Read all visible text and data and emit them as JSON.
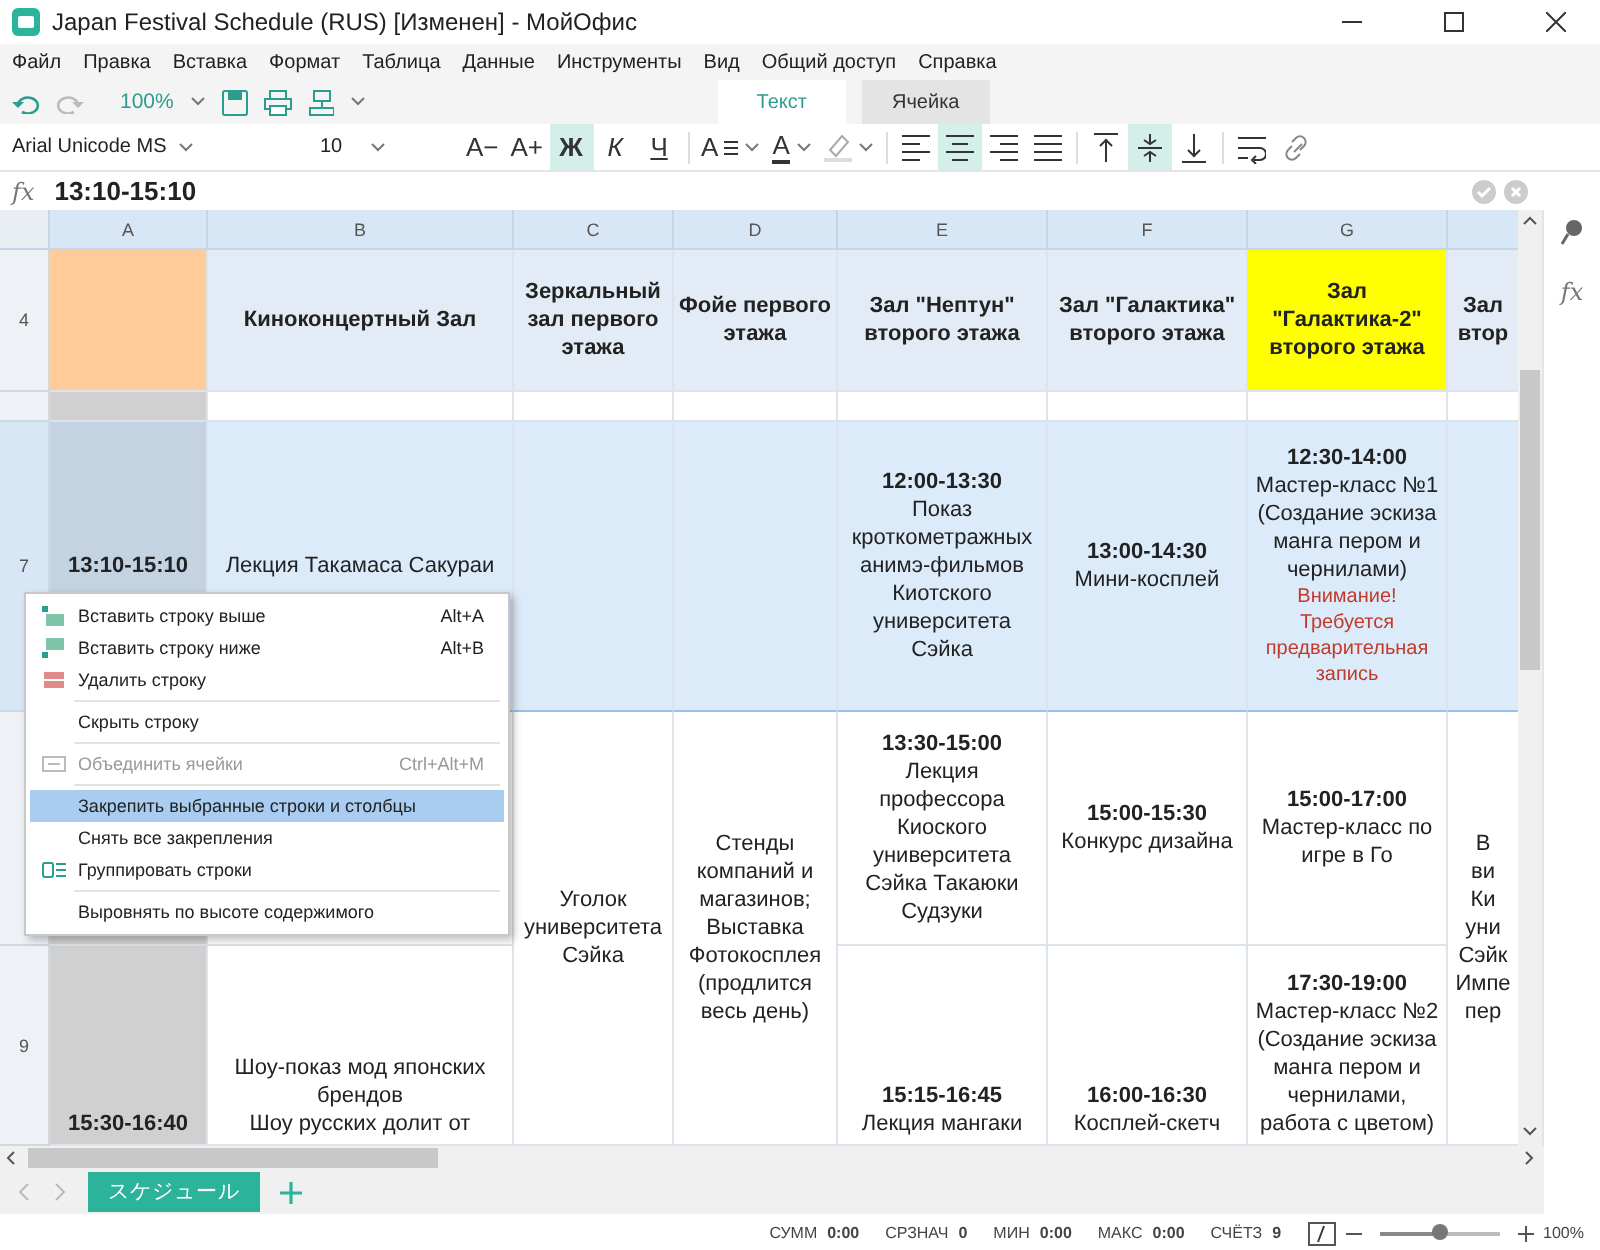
{
  "window": {
    "title": "Japan Festival Schedule (RUS) [Изменен] - МойОфис"
  },
  "menu": [
    "Файл",
    "Правка",
    "Вставка",
    "Формат",
    "Таблица",
    "Данные",
    "Инструменты",
    "Вид",
    "Общий доступ",
    "Справка"
  ],
  "quick_toolbar": {
    "zoom": "100%"
  },
  "ribbon_tabs": [
    {
      "label": "Текст",
      "selected": true
    },
    {
      "label": "Ячейка",
      "selected": false
    }
  ],
  "font": {
    "family": "Arial Unicode MS",
    "size": "10"
  },
  "format_buttons": [
    {
      "kind": "text",
      "label": "A−",
      "on": false
    },
    {
      "kind": "text",
      "label": "A+",
      "on": false
    },
    {
      "kind": "bold",
      "label": "Ж",
      "on": true
    },
    {
      "kind": "italic",
      "label": "К",
      "on": false
    },
    {
      "kind": "underline",
      "label": "Ч",
      "on": false
    },
    {
      "kind": "line-spacing",
      "label": "A",
      "on": false
    },
    {
      "kind": "font-color",
      "label": "A",
      "on": false
    },
    {
      "kind": "highlight",
      "on": false
    },
    {
      "kind": "align-left",
      "on": false
    },
    {
      "kind": "align-center",
      "on": true
    },
    {
      "kind": "align-right",
      "on": false
    },
    {
      "kind": "justify",
      "on": false
    },
    {
      "kind": "valign-top",
      "on": false
    },
    {
      "kind": "valign-middle",
      "on": true
    },
    {
      "kind": "valign-bottom",
      "on": false
    },
    {
      "kind": "wrap",
      "on": false
    },
    {
      "kind": "link",
      "on": false
    }
  ],
  "formula_bar": {
    "label": "fx",
    "value": "13:10-15:10"
  },
  "sheet": {
    "columns": [
      "A",
      "B",
      "C",
      "D",
      "E",
      "F",
      "G"
    ],
    "rows": [
      {
        "header": "4",
        "kind": "header",
        "selected": false,
        "cells": [
          {
            "color": "#ffcc99"
          },
          {
            "lines": [
              {
                "kind": "heading",
                "text": "Киноконцертный Зал"
              }
            ]
          },
          {
            "lines": [
              {
                "kind": "heading",
                "text": "Зеркальный зал первого этажа"
              }
            ]
          },
          {
            "lines": [
              {
                "kind": "heading",
                "text": "Фойе первого этажа"
              }
            ]
          },
          {
            "lines": [
              {
                "kind": "heading",
                "text": "Зал \"Нептун\" второго этажа"
              }
            ]
          },
          {
            "lines": [
              {
                "kind": "heading",
                "text": "Зал \"Галактика\" второго этажа"
              }
            ]
          },
          {
            "color": "#ffff00",
            "lines": [
              {
                "kind": "heading",
                "text": "Зал \"Галактика-2\" второго этажа"
              }
            ]
          },
          {
            "lines": [
              {
                "kind": "heading",
                "text": "Зал втор"
              }
            ]
          }
        ]
      },
      {
        "header": "7",
        "kind": "data",
        "selected": true,
        "cells": [
          {
            "color": "#c3d3e2",
            "lines": [
              {
                "kind": "time",
                "text": "13:10-15:10"
              }
            ]
          },
          {
            "lines": [
              {
                "kind": "text",
                "text": "Лекция Такамаса Сакураи"
              }
            ]
          },
          {},
          {},
          {
            "lines": [
              {
                "kind": "time",
                "text": "12:00-13:30"
              },
              {
                "kind": "text",
                "text": "Показ кроткометражных анимэ-фильмов Киотского университета Сэйка"
              }
            ]
          },
          {
            "lines": [
              {
                "kind": "time",
                "text": "13:00-14:30"
              },
              {
                "kind": "text",
                "text": "Мини-косплей"
              }
            ]
          },
          {
            "lines": [
              {
                "kind": "time",
                "text": "12:30-14:00"
              },
              {
                "kind": "text",
                "text": "Мастер-класс №1 (Создание эскиза манга пером и чернилами)"
              },
              {
                "kind": "warning",
                "text": "Внимание! Требуется предварительная запись"
              }
            ]
          },
          {}
        ]
      },
      {
        "kind": "data",
        "selected": false,
        "cells": [
          {
            "color": "#d0d0d0"
          },
          {},
          {
            "rowspan": 2,
            "lines": [
              {
                "kind": "text",
                "text": "Уголок университета Сэйка"
              }
            ]
          },
          {
            "rowspan": 2,
            "lines": [
              {
                "kind": "text",
                "text": "Стенды компаний и магазинов; Выставка Фотокосплея (продлится весь день)"
              }
            ]
          },
          {
            "lines": [
              {
                "kind": "time",
                "text": "13:30-15:00"
              },
              {
                "kind": "text",
                "text": "Лекция профессора Киоского университета Сэйка Такаюки Судзуки"
              }
            ]
          },
          {
            "lines": [
              {
                "kind": "time",
                "text": "15:00-15:30"
              },
              {
                "kind": "text",
                "text": "Конкурс дизайна"
              }
            ]
          },
          {
            "lines": [
              {
                "kind": "time",
                "text": "15:00-17:00"
              },
              {
                "kind": "text",
                "text": "Мастер-класс по игре в Го"
              }
            ]
          },
          {
            "rowspan": 2,
            "lines": [
              {
                "kind": "text",
                "text": "В\nви\nКи\nуни\nСэйк\nИмпе\nпер"
              }
            ]
          }
        ]
      },
      {
        "header": "9",
        "kind": "data",
        "selected": false,
        "cells": [
          {
            "color": "#d0d0d0",
            "lines": [
              {
                "kind": "time",
                "text": "15:30-16:40"
              }
            ]
          },
          {
            "lines": [
              {
                "kind": "text",
                "text": "Шоу-показ мод японских брендов"
              },
              {
                "kind": "text",
                "text": "Шоу русских долит от"
              }
            ]
          },
          {
            "lines": [
              {
                "kind": "time",
                "text": "15:15-16:45"
              },
              {
                "kind": "text",
                "text": "Лекция мангаки"
              }
            ]
          },
          {
            "lines": [
              {
                "kind": "time",
                "text": "16:00-16:30"
              },
              {
                "kind": "text",
                "text": "Косплей-скетч"
              }
            ]
          },
          {
            "lines": [
              {
                "kind": "time",
                "text": "17:30-19:00"
              },
              {
                "kind": "text",
                "text": "Мастер-класс №2 (Создание эскиза манга пером и чернилами, работа с цветом)"
              }
            ]
          }
        ]
      }
    ]
  },
  "context_menu": [
    {
      "kind": "item",
      "label": "Вставить строку выше",
      "shortcut": "Alt+A",
      "disabled": false,
      "selected": false
    },
    {
      "kind": "item",
      "label": "Вставить строку ниже",
      "shortcut": "Alt+B",
      "disabled": false,
      "selected": false
    },
    {
      "kind": "item",
      "label": "Удалить строку",
      "disabled": false,
      "selected": false
    },
    {
      "kind": "separator"
    },
    {
      "kind": "item",
      "label": "Скрыть строку",
      "disabled": false,
      "selected": false
    },
    {
      "kind": "separator"
    },
    {
      "kind": "item",
      "label": "Объединить ячейки",
      "shortcut": "Ctrl+Alt+M",
      "disabled": true,
      "selected": false
    },
    {
      "kind": "separator"
    },
    {
      "kind": "item",
      "label": "Закрепить выбранные строки и столбцы",
      "disabled": false,
      "selected": true
    },
    {
      "kind": "item",
      "label": "Снять все закрепления",
      "disabled": false,
      "selected": false
    },
    {
      "kind": "item",
      "label": "Группировать строки",
      "disabled": false,
      "selected": false
    },
    {
      "kind": "separator"
    },
    {
      "kind": "item",
      "label": "Выровнять по высоте содержимого",
      "disabled": false,
      "selected": false
    }
  ],
  "side_panel": {
    "formula_label": "fx"
  },
  "sheet_tabs": [
    {
      "label": "スケジュール",
      "selected": true
    }
  ],
  "status_bar": {
    "stats": [
      {
        "label": "СУММ",
        "value": "0:00"
      },
      {
        "label": "СРЗНАЧ",
        "value": "0"
      },
      {
        "label": "МИН",
        "value": "0:00"
      },
      {
        "label": "МАКС",
        "value": "0:00"
      },
      {
        "label": "СЧЁТЗ",
        "value": "9"
      }
    ],
    "zoom": {
      "level": 0.5,
      "reading": "100%"
    }
  }
}
